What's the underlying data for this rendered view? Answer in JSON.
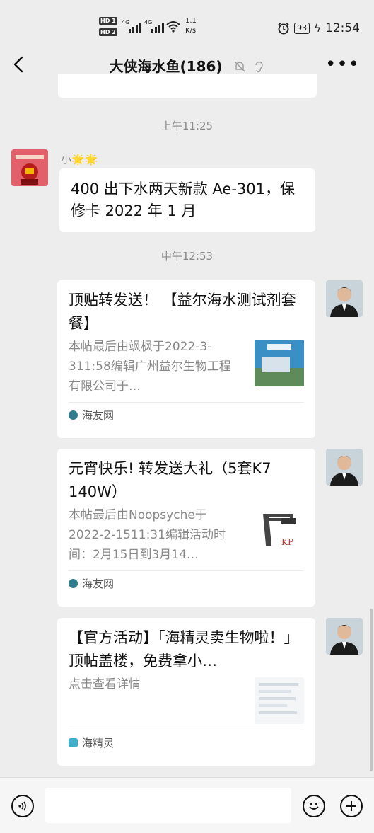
{
  "status_bar": {
    "hd1": "HD 1",
    "hd2": "HD 2",
    "net1": "4G",
    "net2": "4G",
    "speed_value": "1.1",
    "speed_unit": "K/s",
    "battery": "93",
    "time": "12:54"
  },
  "header": {
    "title": "大侠海水鱼(186)"
  },
  "messages": {
    "ts1": "上午11:25",
    "sender_name": "小🌟🌟",
    "text1": "400 出下水两天新款 Ae-301，保修卡 2022 年 1 月",
    "ts2": "中午12:53"
  },
  "cards": [
    {
      "title": "顶贴转发送！ 【益尔海水测试剂套餐】",
      "desc": "本帖最后由飒枫于2022-3-311:58编辑广州益尔生物工程有限公司于…",
      "source": "海友网"
    },
    {
      "title": "元宵快乐! 转发送大礼（5套K7 140W）",
      "desc": "本帖最后由Noopsyche于2022-2-1511:31编辑活动时间：2月15日到3月14…",
      "source": "海友网"
    },
    {
      "title": "【官方活动】「海精灵卖生物啦！」顶帖盖楼，免费拿小…",
      "desc": "点击查看详情",
      "source": "海精灵"
    }
  ],
  "colors": {
    "background": "#ededed",
    "bubble": "#ffffff",
    "muted_text": "#888888"
  }
}
